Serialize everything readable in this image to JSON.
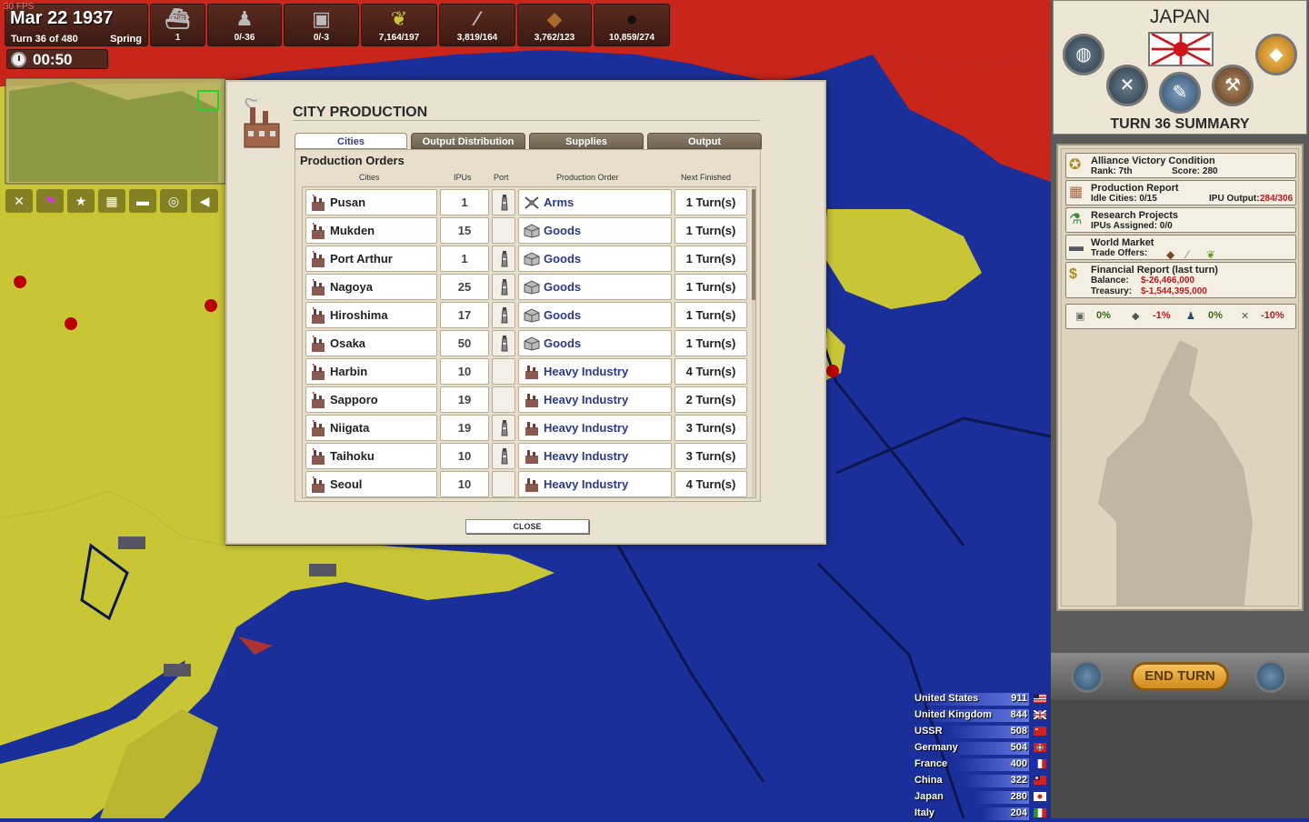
{
  "hud": {
    "fps": "30 FPS",
    "date": "Mar 22 1937",
    "turn": "Turn 36 of 480",
    "season": "Spring",
    "timer": "00:50",
    "resources": [
      {
        "icon": "warship-icon",
        "value": "1"
      },
      {
        "icon": "soldier-icon",
        "value": "0/-36"
      },
      {
        "icon": "goods-crate-icon",
        "value": "0/-3"
      },
      {
        "icon": "wheat-icon",
        "value": "7,164/197"
      },
      {
        "icon": "steel-bar-icon",
        "value": "3,819/164"
      },
      {
        "icon": "ore-icon",
        "value": "3,762/123"
      },
      {
        "icon": "oil-drop-icon",
        "value": "10,859/274"
      }
    ]
  },
  "dialog": {
    "title": "CITY PRODUCTION",
    "tabs": [
      "Cities",
      "Output Distribution",
      "Supplies",
      "Output"
    ],
    "section_title": "Production Orders",
    "columns": [
      "Cities",
      "IPUs",
      "Port",
      "Production Order",
      "Next Finished"
    ],
    "close_label": "CLOSE",
    "rows": [
      {
        "city": "Pusan",
        "ipu": "1",
        "port": true,
        "order": "Arms",
        "order_icon": "arms",
        "next": "1 Turn(s)"
      },
      {
        "city": "Mukden",
        "ipu": "15",
        "port": false,
        "order": "Goods",
        "order_icon": "goods",
        "next": "1 Turn(s)"
      },
      {
        "city": "Port Arthur",
        "ipu": "1",
        "port": true,
        "order": "Goods",
        "order_icon": "goods",
        "next": "1 Turn(s)"
      },
      {
        "city": "Nagoya",
        "ipu": "25",
        "port": true,
        "order": "Goods",
        "order_icon": "goods",
        "next": "1 Turn(s)"
      },
      {
        "city": "Hiroshima",
        "ipu": "17",
        "port": true,
        "order": "Goods",
        "order_icon": "goods",
        "next": "1 Turn(s)"
      },
      {
        "city": "Osaka",
        "ipu": "50",
        "port": true,
        "order": "Goods",
        "order_icon": "goods",
        "next": "1 Turn(s)"
      },
      {
        "city": "Harbin",
        "ipu": "10",
        "port": false,
        "order": "Heavy Industry",
        "order_icon": "industry",
        "next": "4 Turn(s)"
      },
      {
        "city": "Sapporo",
        "ipu": "19",
        "port": false,
        "order": "Heavy Industry",
        "order_icon": "industry",
        "next": "2 Turn(s)"
      },
      {
        "city": "Niigata",
        "ipu": "19",
        "port": true,
        "order": "Heavy Industry",
        "order_icon": "industry",
        "next": "3 Turn(s)"
      },
      {
        "city": "Taihoku",
        "ipu": "10",
        "port": true,
        "order": "Heavy Industry",
        "order_icon": "industry",
        "next": "3 Turn(s)"
      },
      {
        "city": "Seoul",
        "ipu": "10",
        "port": false,
        "order": "Heavy Industry",
        "order_icon": "industry",
        "next": "4 Turn(s)"
      }
    ]
  },
  "side": {
    "nation": "JAPAN",
    "summary_title": "TURN 36 SUMMARY",
    "victory": {
      "title": "Alliance Victory Condition",
      "rank": "Rank: 7th",
      "score": "Score: 280"
    },
    "production": {
      "title": "Production Report",
      "idle": "Idle Cities: 0/15",
      "ipu_label": "IPU Output:",
      "ipu_value": "284/306"
    },
    "research": {
      "title": "Research Projects",
      "assigned": "IPUs Assigned: 0/0"
    },
    "market": {
      "title": "World Market",
      "offers": "Trade Offers:"
    },
    "finance": {
      "title": "Financial Report (last turn)",
      "balance_label": "Balance:",
      "balance": "$-26,466,000",
      "treasury_label": "Treasury:",
      "treasury": "$-1,544,395,000"
    },
    "modifiers": [
      "0%",
      "-1%",
      "0%",
      "-10%"
    ],
    "end_turn": "END TURN"
  },
  "scoreboard": [
    {
      "name": "United States",
      "score": "911"
    },
    {
      "name": "United Kingdom",
      "score": "844"
    },
    {
      "name": "USSR",
      "score": "508"
    },
    {
      "name": "Germany",
      "score": "504"
    },
    {
      "name": "France",
      "score": "400"
    },
    {
      "name": "China",
      "score": "322"
    },
    {
      "name": "Japan",
      "score": "280"
    },
    {
      "name": "Italy",
      "score": "204"
    }
  ],
  "colors": {
    "sea": "#1a2f9a",
    "land": "#c9c636",
    "enemy": "#c8261a",
    "accent": "#2a3a8a"
  }
}
